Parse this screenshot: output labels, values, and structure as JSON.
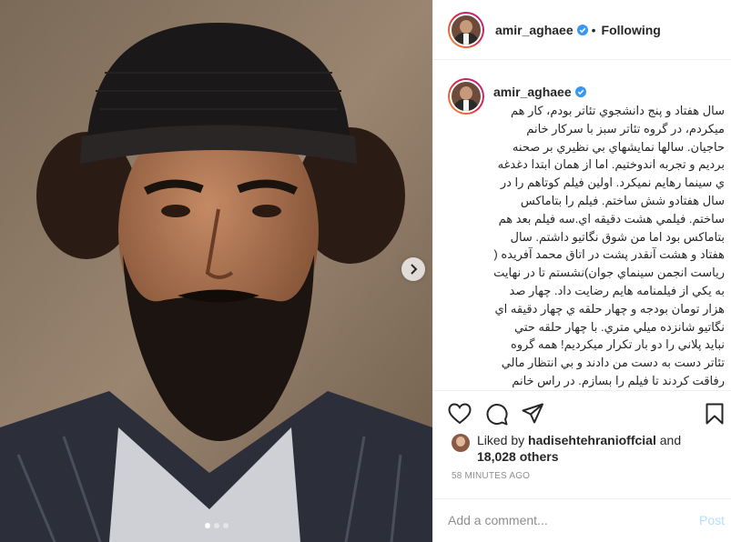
{
  "post": {
    "photo": {
      "description_icon": "portrait-photo",
      "slide_count": 3,
      "active_slide": 1
    },
    "header": {
      "username": "amir_aghaee",
      "separator": "•",
      "follow_label": "Following"
    },
    "caption": {
      "username": "amir_aghaee",
      "text": "سال هفتاد و پنج دانشجوي تئاتر بودم، كار هم ميكردم، در گروه تئاتر سبز با سركار خانم حاجيان. سالها نمايشهاي بي نظيري بر صحنه برديم و تجربه اندوختيم. اما از همان ابتدا دغدغه ي سينما رهايم نميكرد. اولين فيلم كوتاهم را در سال هفتادو شش ساختم. فيلم را بتاماكس ساختم. فيلمي هشت دقيقه اي.سه فيلم بعد هم بتاماكس بود اما من شوق نگاتيو داشتم. سال هفتاد و هشت آنقدر پشت در اتاق محمد آفريده ( رياست انجمن سينماي جوان)نشستم تا در نهايت به يكي از فيلمنامه هايم رضايت داد. چهار صد هزار تومان بودجه و چهار حلقه ي چهار دقيقه اي نگاتيو شانزده ميلي متري. با چهار حلقه حتي نبايد پلاني را دو بار تكرار ميكرديم! همه گروه تئاتر دست به دست من دادند و بي انتظار مالي رفاقت كردند تا فيلم را بسازم. در راس خانم حاجيان كه مشاور بود. سيما جان تير انداز قبول زحمت بازي كرد. امير توسلي موسيقي را قبول كرد. سعيد پور اسماعيلي"
    },
    "likes": {
      "prefix": "Liked by",
      "liker": "hadisehtehranioffcial",
      "and": "and",
      "others": "18,028 others"
    },
    "timestamp": "58 MINUTES AGO",
    "comment_box": {
      "placeholder": "Add a comment...",
      "post_label": "Post"
    },
    "colors": {
      "verified": "#3897f0",
      "post_disabled": "#b2dffc",
      "border": "#efefef"
    }
  }
}
